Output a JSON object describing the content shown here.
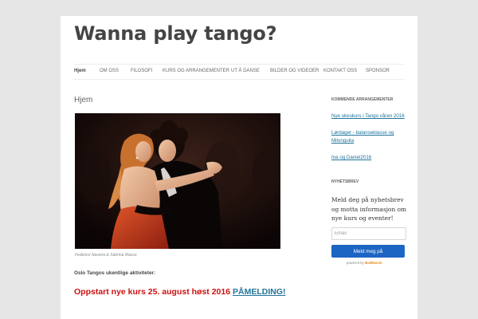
{
  "site": {
    "title": "Wanna play tango?"
  },
  "nav": {
    "items": [
      {
        "label": "Hjem"
      },
      {
        "label": "OM OSS"
      },
      {
        "label": "FILOSOFI"
      },
      {
        "label": "KURS OG ARRANGEMENTER"
      },
      {
        "label": "UT Å DANSE"
      },
      {
        "label": "BILDER OG VIDEOER"
      },
      {
        "label": "KONTAKT OSS"
      },
      {
        "label": "SPONSOR"
      }
    ]
  },
  "main": {
    "title": "Hjem",
    "image_caption": "Federico Naveira & Sabrina Masso",
    "activities_label": "Oslo Tangos ukentlige aktiviteter:",
    "announcement_text": "Oppstart nye kurs 25. august høst 2016",
    "announcement_link": "PÅMELDING!"
  },
  "sidebar": {
    "upcoming": {
      "title": "KOMMENDE ARRANGEMENTER",
      "events": [
        {
          "label": "Nye ukeskurs i Tango våren 2016"
        },
        {
          "label": "Lørdager - balanseklasse og Milonguita"
        },
        {
          "label": "Ina og Daniel2016"
        }
      ]
    },
    "newsletter": {
      "title": "NYHETSBREV",
      "text": "Meld deg på nyhetsbrev og motta informasjon om nye kurs og eventer!",
      "email_placeholder": "Email",
      "button_label": "Meld meg på",
      "powered_by_prefix": "powered by",
      "powered_by_brand": "MailMunch"
    }
  },
  "colors": {
    "link": "#21759b",
    "announcement": "#cc1111",
    "button": "#1d65c2",
    "page_bg": "#e6e6e6"
  }
}
